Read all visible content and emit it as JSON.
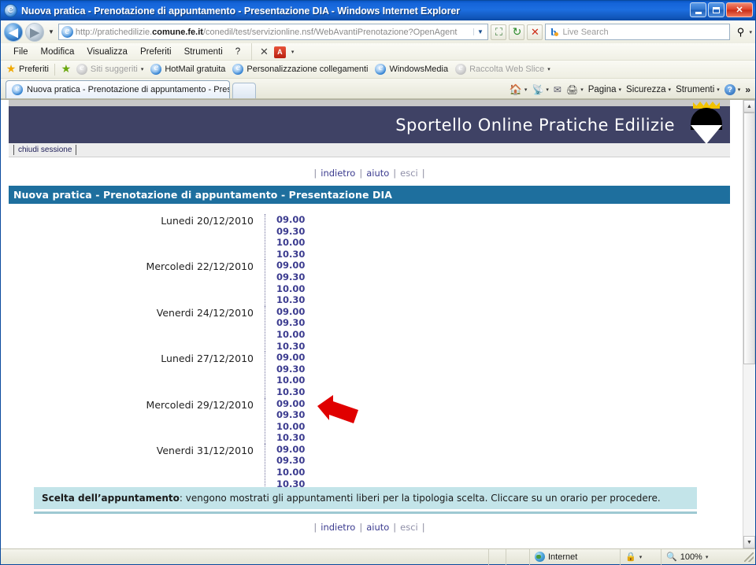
{
  "window": {
    "title": "Nuova pratica - Prenotazione di appuntamento - Presentazione DIA - Windows Internet Explorer",
    "minimize_label": "Riduci a icona",
    "maximize_label": "Ripristina",
    "close_label": "Chiudi"
  },
  "address_bar": {
    "url_prefix": "http://pratichedilizie.",
    "url_domain": "comune.fe.it",
    "url_suffix": "/conedil/test/servizionline.nsf/WebAvantiPrenotazione?OpenAgent",
    "url_full": "http://pratichedilizie.comune.fe.it/conedil/test/servizionline.nsf/WebAvantiPrenotazione?OpenAgent",
    "back_glyph": "◀",
    "forward_glyph": "▶",
    "history_caret": "▼",
    "dropdown_caret": "▼",
    "compat_glyph": "⛶",
    "refresh_glyph": "↻",
    "stop_glyph": "✕",
    "search_placeholder": "Live Search",
    "search_brand": "b",
    "search_go_glyph": "⚲",
    "search_caret": "▾"
  },
  "menubar": {
    "items": [
      {
        "label": "File"
      },
      {
        "label": "Modifica"
      },
      {
        "label": "Visualizza"
      },
      {
        "label": "Preferiti"
      },
      {
        "label": "Strumenti"
      },
      {
        "label": "?"
      }
    ],
    "close_glyph": "✕",
    "pdf_label": "A",
    "pdf_caret": "▾"
  },
  "favorites_bar": {
    "favorites_label": "Preferiti",
    "items": [
      {
        "label": "Siti suggeriti",
        "icon": "ie-icon",
        "dim": true,
        "caret": "▾"
      },
      {
        "label": "HotMail gratuita",
        "icon": "ie-icon",
        "dim": false,
        "caret": ""
      },
      {
        "label": "Personalizzazione collegamenti",
        "icon": "ie-icon",
        "dim": false,
        "caret": ""
      },
      {
        "label": "WindowsMedia",
        "icon": "ie-icon",
        "dim": false,
        "caret": ""
      },
      {
        "label": "Raccolta Web Slice",
        "icon": "ie-icon",
        "dim": true,
        "caret": "▾"
      }
    ]
  },
  "tabbar": {
    "tab_label": "Nuova pratica - Prenotazione di appuntamento - Pres...",
    "new_tab_label": "",
    "commands": [
      {
        "label": "",
        "icon": "home-icon",
        "caret": "▾"
      },
      {
        "label": "",
        "icon": "rss-icon",
        "caret": "▾"
      },
      {
        "label": "",
        "icon": "mail-icon",
        "caret": ""
      },
      {
        "label": "",
        "icon": "print-icon",
        "caret": "▾"
      },
      {
        "label": "Pagina",
        "icon": "",
        "caret": "▾"
      },
      {
        "label": "Sicurezza",
        "icon": "",
        "caret": "▾"
      },
      {
        "label": "Strumenti",
        "icon": "",
        "caret": "▾"
      },
      {
        "label": "",
        "icon": "help-icon",
        "caret": "▾"
      }
    ],
    "overflow_glyph": "»"
  },
  "site": {
    "header_title": "Sportello Online Pratiche Edilizie",
    "close_session": "chiudi sessione",
    "page_banner": "Nuova pratica - Prenotazione di appuntamento - Presentazione DIA",
    "nav": {
      "open_pipe": "|",
      "back": "indietro",
      "help": "aiuto",
      "exit": "esci",
      "close_pipe": "|",
      "sep": "|"
    },
    "info": {
      "strong": "Scelta dell’appuntamento",
      "text": ": vengono mostrati gli appuntamenti liberi per la tipologia scelta. Cliccare su un orario per procedere."
    }
  },
  "appointments": [
    {
      "date": "Lunedi 20/12/2010",
      "times": [
        "09.00",
        "09.30",
        "10.00",
        "10.30"
      ]
    },
    {
      "date": "Mercoledi 22/12/2010",
      "times": [
        "09.00",
        "09.30",
        "10.00",
        "10.30"
      ]
    },
    {
      "date": "Venerdi 24/12/2010",
      "times": [
        "09.00",
        "09.30",
        "10.00",
        "10.30"
      ]
    },
    {
      "date": "Lunedi 27/12/2010",
      "times": [
        "09.00",
        "09.30",
        "10.00",
        "10.30"
      ]
    },
    {
      "date": "Mercoledi 29/12/2010",
      "times": [
        "09.00",
        "09.30",
        "10.00",
        "10.30"
      ]
    },
    {
      "date": "Venerdi 31/12/2010",
      "times": [
        "09.00",
        "09.30",
        "10.00",
        "10.30"
      ]
    }
  ],
  "statusbar": {
    "zone": "Internet",
    "zoom": "100%",
    "zone_caret": "▾",
    "zoom_caret": "▾"
  },
  "scrollbar": {
    "up_glyph": "▲",
    "down_glyph": "▼"
  },
  "colors": {
    "title_blue": "#1464d8",
    "site_header": "#3f4265",
    "page_banner": "#1e6f9e",
    "info_strip": "#c3e4e9",
    "link_blue": "#3b3b8f",
    "arrow_red": "#e00000"
  }
}
